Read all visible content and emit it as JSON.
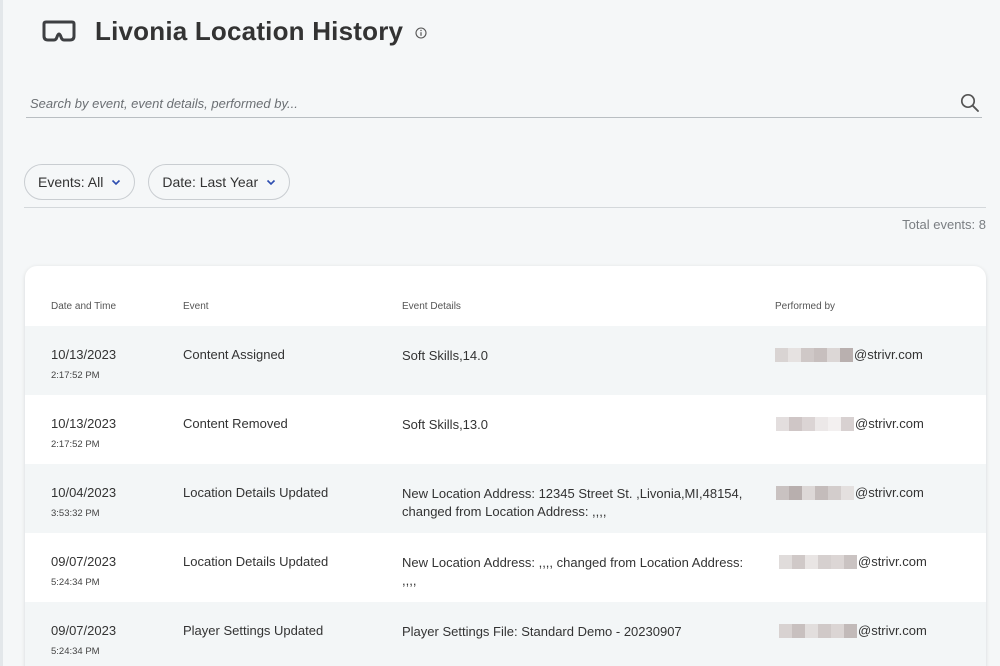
{
  "header": {
    "title": "Livonia Location History"
  },
  "search": {
    "placeholder": "Search by event, event details, performed by..."
  },
  "filters": {
    "events_label": "Events: All",
    "date_label": "Date: Last Year"
  },
  "summary": {
    "total_events": "Total events: 8"
  },
  "table": {
    "columns": [
      "Date and Time",
      "Event",
      "Event Details",
      "Performed by"
    ],
    "rows": [
      {
        "date": "10/13/2023",
        "time": "2:17:52 PM",
        "event": "Content Assigned",
        "details": "Soft Skills,14.0",
        "performed_by": "@strivr.com"
      },
      {
        "date": "10/13/2023",
        "time": "2:17:52 PM",
        "event": "Content Removed",
        "details": "Soft Skills,13.0",
        "performed_by": "@strivr.com"
      },
      {
        "date": "10/04/2023",
        "time": "3:53:32 PM",
        "event": "Location Details Updated",
        "details": "New Location Address: 12345 Street St. ,Livonia,MI,48154, changed from Location Address: ,,,,",
        "performed_by": "@strivr.com"
      },
      {
        "date": "09/07/2023",
        "time": "5:24:34 PM",
        "event": "Location Details Updated",
        "details": "New Location Address: ,,,, changed from Location Address: ,,,,",
        "performed_by": "@strivr.com"
      },
      {
        "date": "09/07/2023",
        "time": "5:24:34 PM",
        "event": "Player Settings Updated",
        "details": "Player Settings File: Standard Demo - 20230907",
        "performed_by": "@strivr.com"
      }
    ]
  },
  "icons": {
    "header": "vr-headset-icon",
    "title_info": "info-icon",
    "search": "search-icon",
    "dropdown": "chevron-down-icon"
  },
  "colors": {
    "background": "#f5f7f8",
    "row_shade": "#f3f6f7",
    "chevron": "#2d4db0",
    "text": "#333333"
  }
}
